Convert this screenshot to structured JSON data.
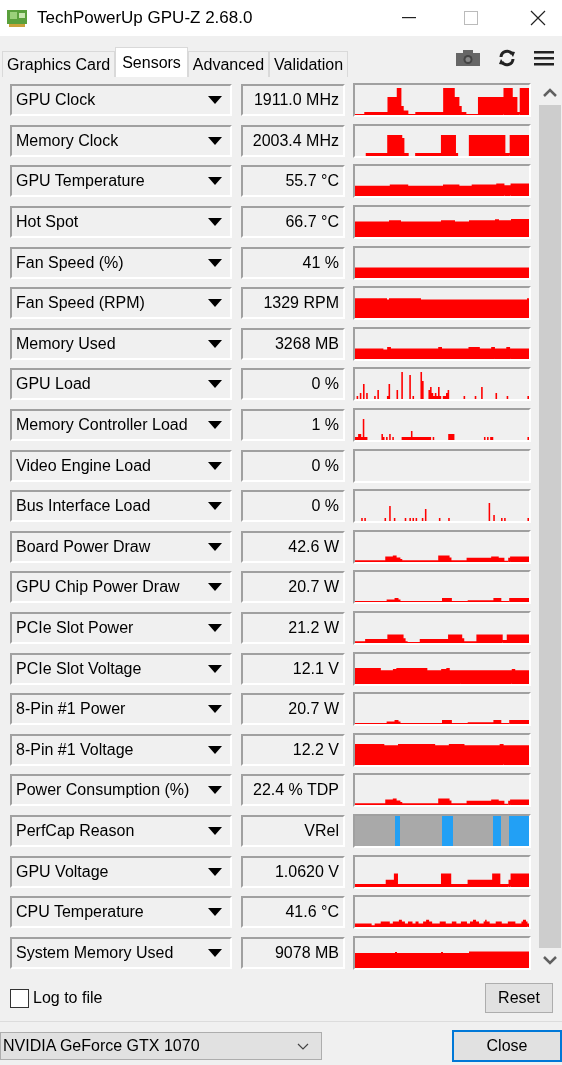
{
  "window": {
    "title": "TechPowerUp GPU-Z 2.68.0"
  },
  "tabs": [
    {
      "label": "Graphics Card",
      "selected": false
    },
    {
      "label": "Sensors",
      "selected": true
    },
    {
      "label": "Advanced",
      "selected": false
    },
    {
      "label": "Validation",
      "selected": false
    }
  ],
  "sensors": [
    {
      "name": "GPU Clock",
      "value": "1911.0 MHz",
      "kind": "graph"
    },
    {
      "name": "Memory Clock",
      "value": "2003.4 MHz",
      "kind": "graph"
    },
    {
      "name": "GPU Temperature",
      "value": "55.7 °C",
      "kind": "graph"
    },
    {
      "name": "Hot Spot",
      "value": "66.7 °C",
      "kind": "graph"
    },
    {
      "name": "Fan Speed (%)",
      "value": "41 %",
      "kind": "graph"
    },
    {
      "name": "Fan Speed (RPM)",
      "value": "1329 RPM",
      "kind": "graph"
    },
    {
      "name": "Memory Used",
      "value": "3268 MB",
      "kind": "graph"
    },
    {
      "name": "GPU Load",
      "value": "0 %",
      "kind": "graph"
    },
    {
      "name": "Memory Controller Load",
      "value": "1 %",
      "kind": "graph"
    },
    {
      "name": "Video Engine Load",
      "value": "0 %",
      "kind": "graph"
    },
    {
      "name": "Bus Interface Load",
      "value": "0 %",
      "kind": "graph"
    },
    {
      "name": "Board Power Draw",
      "value": "42.6 W",
      "kind": "graph"
    },
    {
      "name": "GPU Chip Power Draw",
      "value": "20.7 W",
      "kind": "graph"
    },
    {
      "name": "PCIe Slot Power",
      "value": "21.2 W",
      "kind": "graph"
    },
    {
      "name": "PCIe Slot Voltage",
      "value": "12.1 V",
      "kind": "graph"
    },
    {
      "name": "8-Pin #1 Power",
      "value": "20.7 W",
      "kind": "graph"
    },
    {
      "name": "8-Pin #1 Voltage",
      "value": "12.2 V",
      "kind": "graph"
    },
    {
      "name": "Power Consumption (%)",
      "value": "22.4 % TDP",
      "kind": "graph"
    },
    {
      "name": "PerfCap Reason",
      "value": "VRel",
      "kind": "perfcap"
    },
    {
      "name": "GPU Voltage",
      "value": "1.0620 V",
      "kind": "graph"
    },
    {
      "name": "CPU Temperature",
      "value": "41.6 °C",
      "kind": "graph"
    },
    {
      "name": "System Memory Used",
      "value": "9078 MB",
      "kind": "graph"
    }
  ],
  "log_to_file": {
    "label": "Log to file",
    "checked": false
  },
  "reset_button": "Reset",
  "gpu_select": {
    "value": "NVIDIA GeForce GTX 1070"
  },
  "close_button": "Close"
}
